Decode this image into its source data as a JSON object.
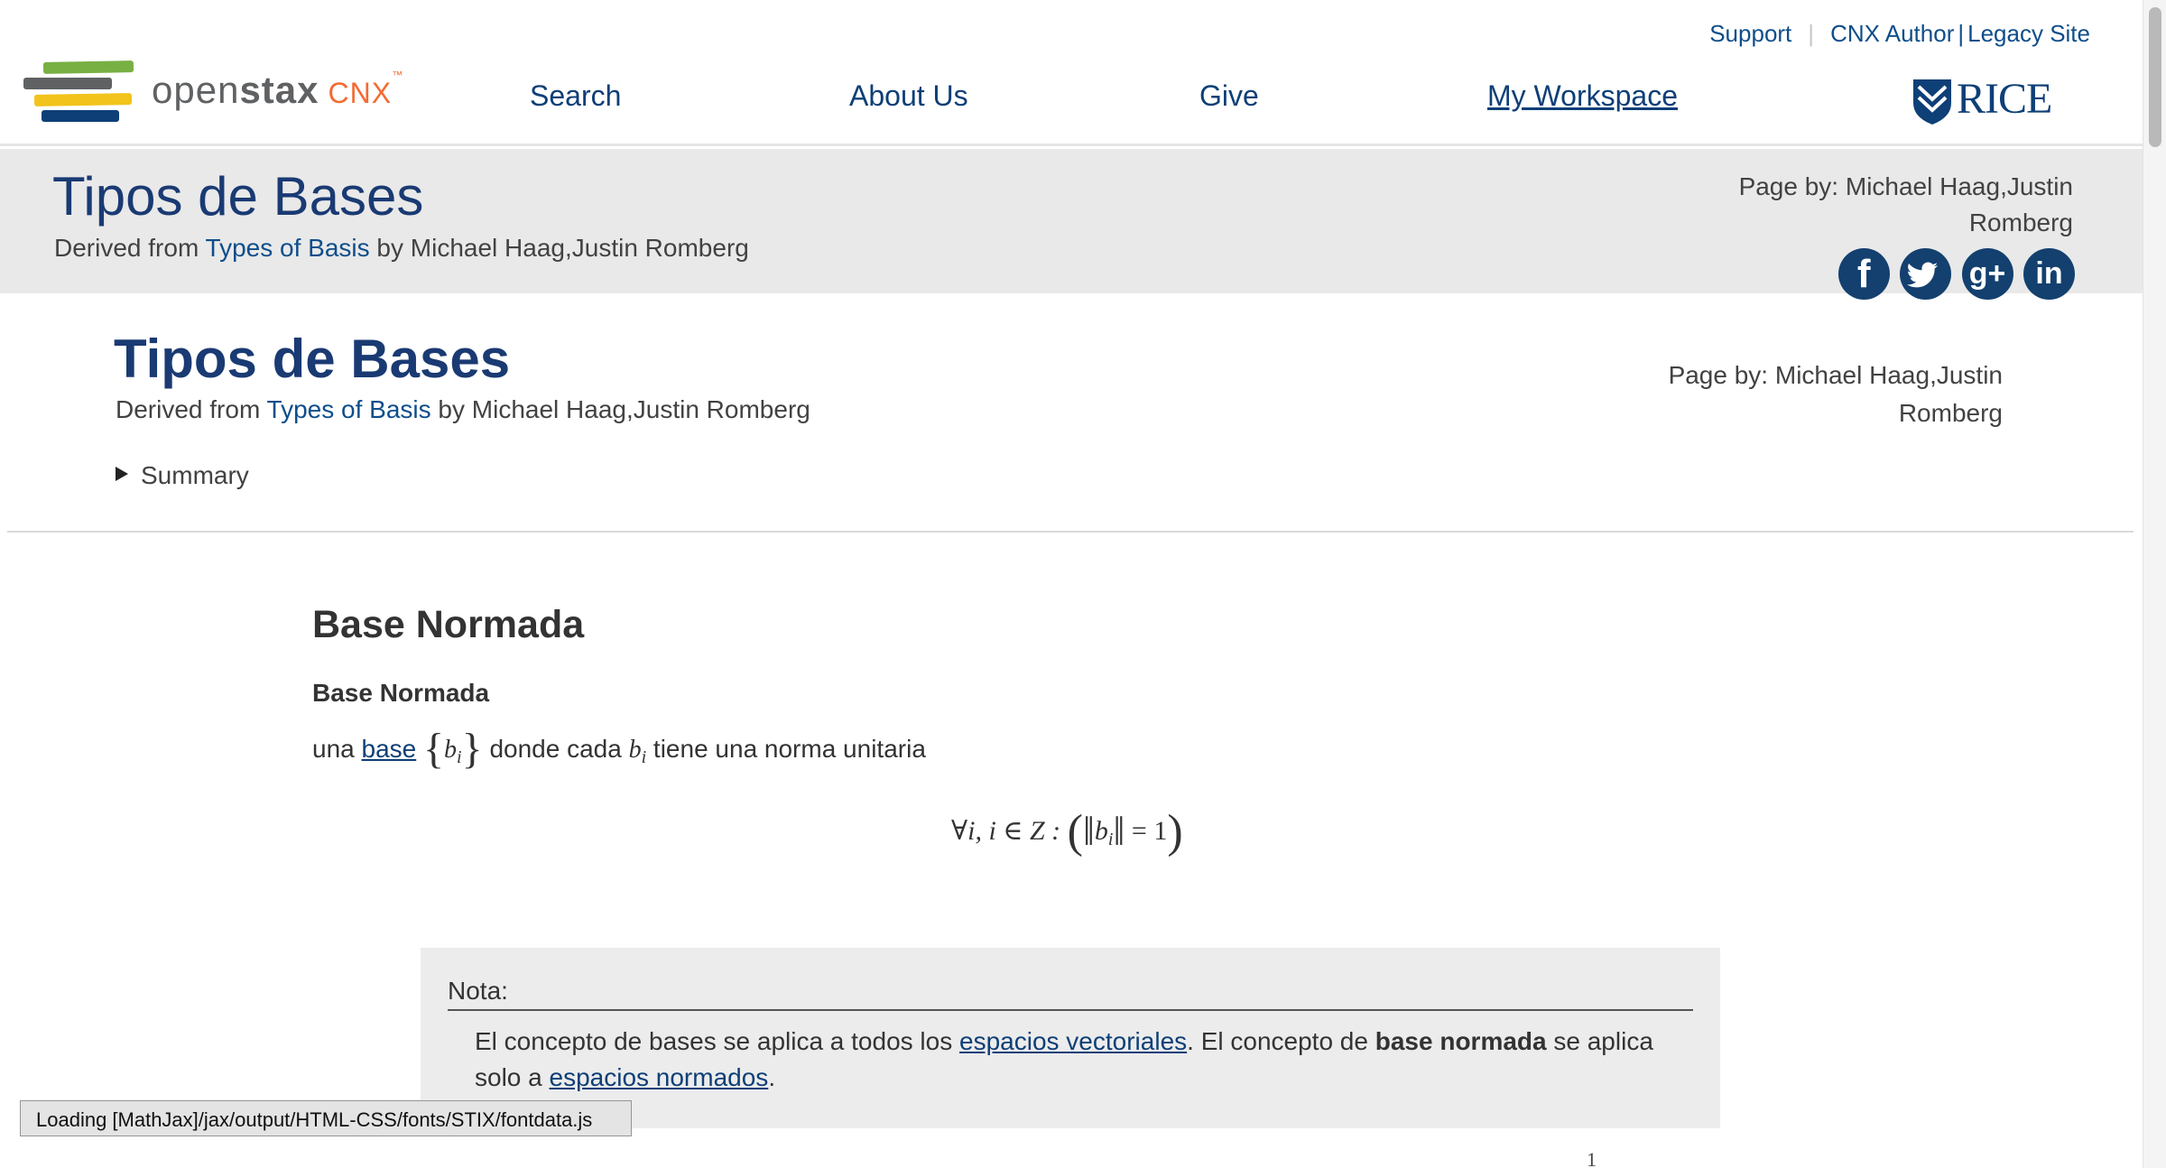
{
  "header": {
    "logo": {
      "brand_light": "open",
      "brand_bold": "stax",
      "product": "CNX",
      "trademark": "™",
      "bar_colors": [
        "#78b043",
        "#5f6163",
        "#f2c31b",
        "#0e3f77"
      ]
    },
    "utility_links": {
      "support": "Support",
      "cnx_author": "CNX Author",
      "divider": "|",
      "legacy_site": "Legacy Site"
    },
    "nav": {
      "search": "Search",
      "about": "About Us",
      "give": "Give",
      "workspace": "My Workspace"
    },
    "partner_logo": "RICE"
  },
  "title_band": {
    "title": "Tipos de Bases",
    "derived_prefix": "Derived from",
    "derived_link": "Types of Basis",
    "derived_suffix": "by Michael Haag,Justin Romberg",
    "page_by": "Page by: Michael Haag,Justin Romberg",
    "social": [
      {
        "icon": "facebook-icon",
        "glyph": "f"
      },
      {
        "icon": "twitter-icon",
        "glyph": "🐦"
      },
      {
        "icon": "google-plus-icon",
        "glyph": "g+"
      },
      {
        "icon": "linkedin-icon",
        "glyph": "in"
      }
    ]
  },
  "content_header": {
    "title": "Tipos de Bases",
    "derived_prefix": "Derived from",
    "derived_link": "Types of Basis",
    "derived_suffix": "by Michael Haag,Justin Romberg",
    "page_by": "Page by: Michael Haag,Justin Romberg",
    "summary": "Summary"
  },
  "article": {
    "section_title": "Base Normada",
    "definition_term": "Base Normada",
    "def_una": "una",
    "def_link": "base",
    "def_set_var": "b",
    "def_sub": "i",
    "def_middle": "donde cada",
    "def_end": "tiene una norma unitaria",
    "equation": {
      "forall": "∀i, i ∈ Z :",
      "var": "b",
      "sub": "i",
      "rhs": "= 1"
    },
    "note": {
      "label": "Nota:",
      "text_1": "El concepto de bases se aplica a todos los",
      "link_1": "espacios vectoriales",
      "text_2": ". El concepto de",
      "bold": "base normada",
      "text_3": "se aplica solo a",
      "link_2": "espacios normados",
      "text_4": "."
    },
    "stray_glyph": "1"
  },
  "status": {
    "loading": "Loading [MathJax]/jax/output/HTML-CSS/fonts/STIX/fontdata.js"
  }
}
